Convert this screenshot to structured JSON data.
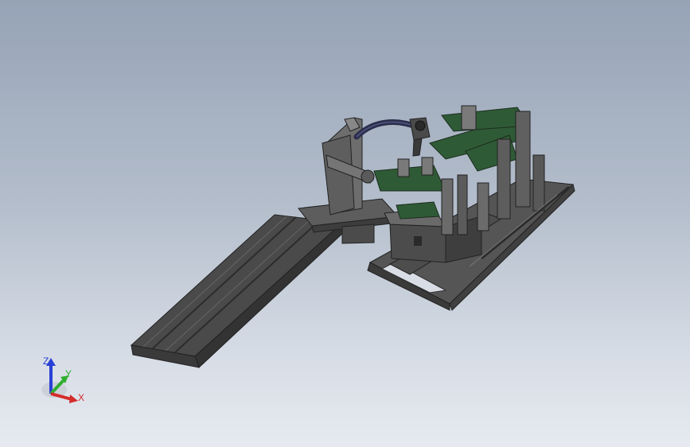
{
  "triad": {
    "x_label": "X",
    "y_label": "Y",
    "z_label": "Z",
    "x_color": "#d42b2b",
    "y_color": "#2fae2f",
    "z_color": "#2a3fd6"
  },
  "colors": {
    "frame": "#5b5b5b",
    "frame_dark": "#3f3f3f",
    "frame_light": "#7d7d7d",
    "green_plate": "#2f5a36",
    "hose": "#2a2d4a",
    "background_top": "#96a3b6",
    "background_bottom": "#e6eaf0"
  }
}
